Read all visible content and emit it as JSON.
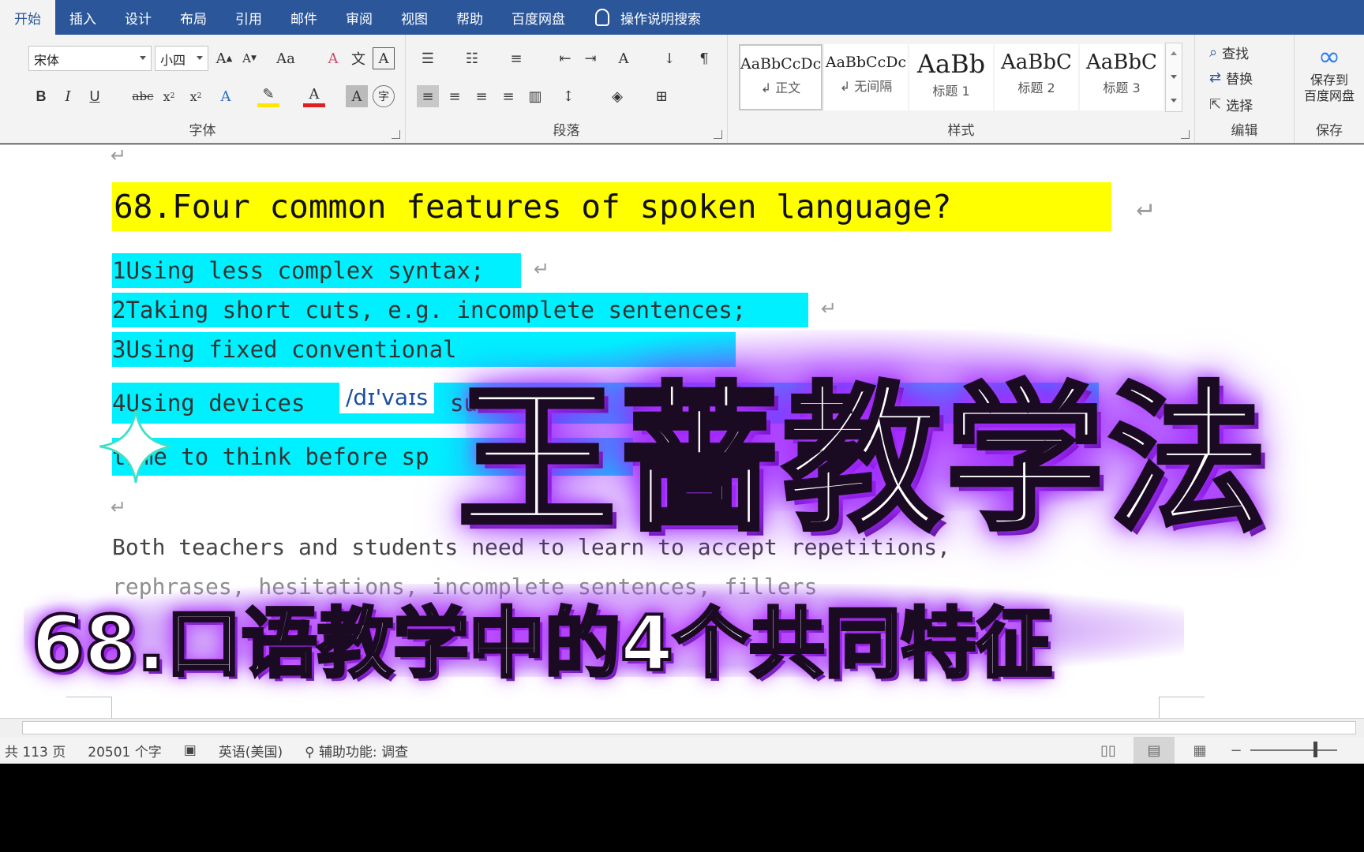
{
  "ribbon": {
    "tabs": [
      "开始",
      "插入",
      "设计",
      "布局",
      "引用",
      "邮件",
      "审阅",
      "视图",
      "帮助",
      "百度网盘"
    ],
    "search_label": "操作说明搜索",
    "font": {
      "font_name": "宋体",
      "font_size": "小四",
      "group_label": "字体"
    },
    "paragraph_group_label": "段落",
    "styles": {
      "group_label": "样式",
      "items": [
        {
          "sample": "AaBbCcDc",
          "name": "↲ 正文"
        },
        {
          "sample": "AaBbCcDc",
          "name": "↲ 无间隔"
        },
        {
          "sample": "AaBb",
          "name": "标题 1"
        },
        {
          "sample": "AaBbC",
          "name": "标题 2"
        },
        {
          "sample": "AaBbC",
          "name": "标题 3"
        }
      ]
    },
    "editing": {
      "find": "查找",
      "replace": "替换",
      "select": "选择",
      "group_label": "编辑"
    },
    "save": {
      "button_label_1": "保存到",
      "button_label_2": "百度网盘",
      "group_label": "保存"
    }
  },
  "document": {
    "heading": "68.Four common features of spoken language?",
    "items": [
      "1Using less complex syntax;",
      "2Taking short cuts, e.g. incomplete sentences;",
      "3Using fixed conventional",
      "4Using devices",
      "time to think before sp"
    ],
    "item4_tail": "su",
    "pronunciation": "/dɪ'vaɪs",
    "paragraph_line1": "Both teachers and students need to learn to accept repetitions,",
    "paragraph_line2": "rephrases, hesitations, incomplete sentences, fillers"
  },
  "overlay": {
    "title": "王蔷教学法",
    "subtitle": "68.口语教学中的4个共同特征"
  },
  "statusbar": {
    "pages": "共 113 页",
    "words": "20501 个字",
    "language": "英语(美国)",
    "accessibility": "辅助功能: 调查"
  },
  "colors": {
    "ribbon_blue": "#2b579a",
    "highlight_yellow": "#ffff00",
    "highlight_cyan": "#00f0ff",
    "glow_purple": "#a020ff"
  }
}
